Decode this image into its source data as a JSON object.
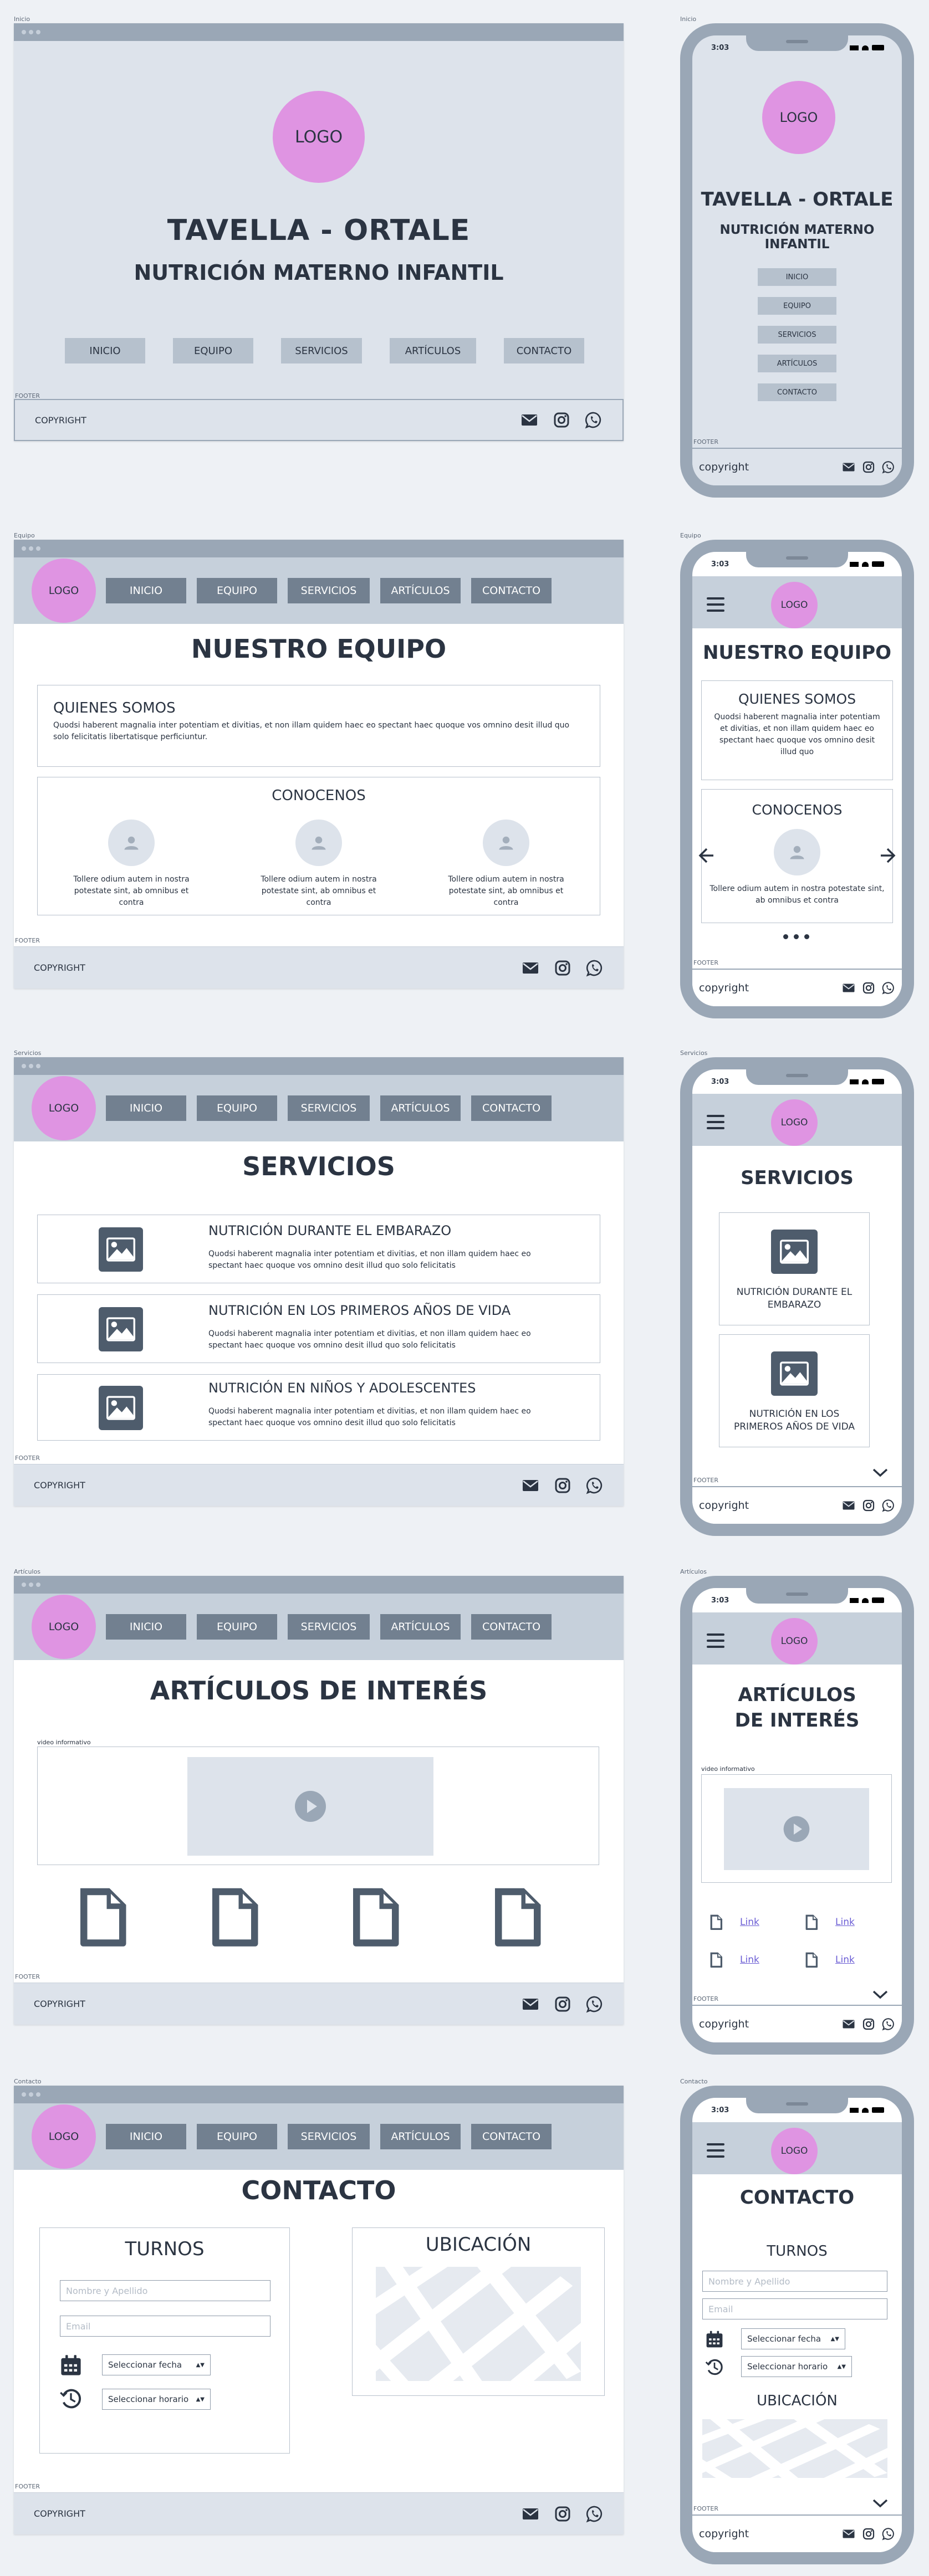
{
  "screens": {
    "inicio": {
      "label": "Inicio"
    },
    "equipo": {
      "label": "Equipo"
    },
    "servicios": {
      "label": "Servicios"
    },
    "articulos": {
      "label": "Artículos"
    },
    "contacto": {
      "label": "Contacto"
    }
  },
  "logo": "LOGO",
  "home": {
    "title": "TAVELLA - ORTALE",
    "subtitle": "NUTRICIÓN MATERNO INFANTIL",
    "nav": [
      "INICIO",
      "EQUIPO",
      "SERVICIOS",
      "ARTÍCULOS",
      "CONTACTO"
    ]
  },
  "footer": {
    "label": "FOOTER",
    "copyright_desktop": "COPYRIGHT",
    "copyright_mobile": "copyright",
    "icons": [
      "mail-icon",
      "instagram-icon",
      "whatsapp-icon"
    ]
  },
  "nav": [
    "INICIO",
    "EQUIPO",
    "SERVICIOS",
    "ARTÍCULOS",
    "CONTACTO"
  ],
  "phone": {
    "time": "3:03"
  },
  "equipo": {
    "title": "NUESTRO EQUIPO",
    "about_title": "QUIENES SOMOS",
    "about_text": "Quodsi haberent magnalia inter potentiam et divitias, et non illam quidem haec eo spectant haec quoque vos omnino desit illud quo solo felicitatis libertatisque perficiuntur.",
    "about_text_mobile": "Quodsi haberent magnalia inter potentiam et divitias, et non illam quidem haec eo spectant haec quoque vos omnino desit illud quo",
    "know_title": "CONOCENOS",
    "member_text": "Tollere odium autem in nostra potestate sint, ab omnibus et contra"
  },
  "servicios": {
    "title": "SERVICIOS",
    "items": [
      {
        "title": "NUTRICIÓN DURANTE EL EMBARAZO",
        "text": "Quodsi haberent magnalia inter potentiam et divitias, et non illam quidem haec eo spectant haec quoque vos omnino desit illud quo solo felicitatis"
      },
      {
        "title": "NUTRICIÓN EN LOS PRIMEROS AÑOS DE VIDA",
        "text": "Quodsi haberent magnalia inter potentiam et divitias, et non illam quidem haec eo spectant haec quoque vos omnino desit illud quo solo felicitatis"
      },
      {
        "title": "NUTRICIÓN EN NIÑOS Y ADOLESCENTES",
        "text": "Quodsi haberent magnalia inter potentiam et divitias, et non illam quidem haec eo spectant haec quoque vos omnino desit illud quo solo felicitatis"
      }
    ],
    "mobile_items": [
      "NUTRICIÓN DURANTE EL EMBARAZO",
      "NUTRICIÓN EN LOS PRIMEROS AÑOS DE VIDA"
    ]
  },
  "articulos": {
    "title": "ARTÍCULOS DE INTERÉS",
    "title_line1": "ARTÍCULOS",
    "title_line2": "DE INTERÉS",
    "video_label": "video informativo",
    "link": "Link"
  },
  "contacto": {
    "title": "CONTACTO",
    "turnos": "TURNOS",
    "ubicacion": "UBICACIÓN",
    "name_placeholder": "Nombre y Apellido",
    "email_placeholder": "Email",
    "date_select": "Seleccionar fecha",
    "time_select": "Seleccionar horario"
  }
}
